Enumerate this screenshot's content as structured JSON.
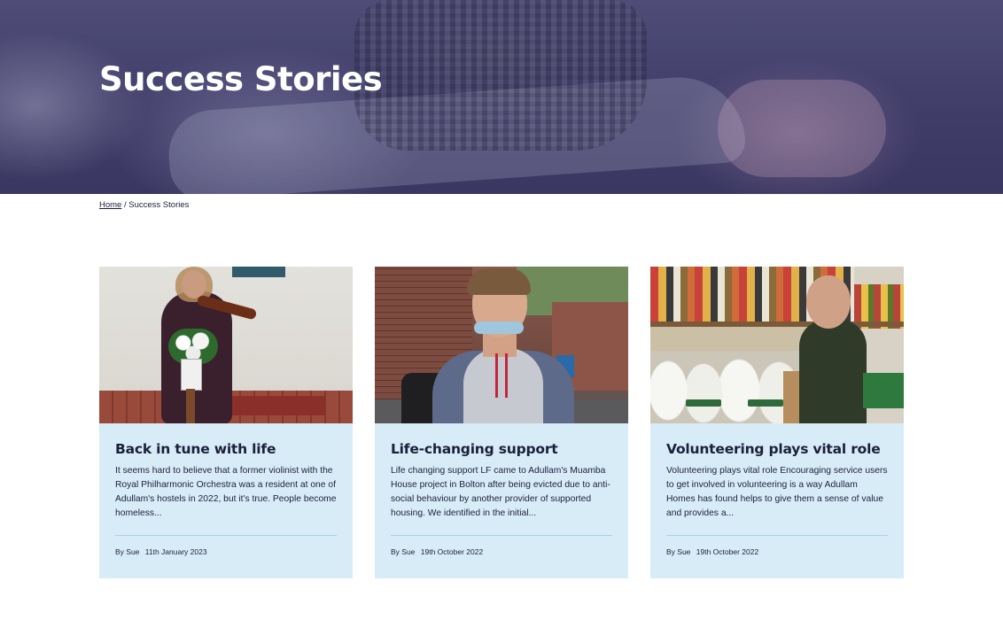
{
  "hero": {
    "title": "Success Stories"
  },
  "breadcrumb": {
    "home_label": "Home",
    "separator": "/",
    "current": "Success Stories"
  },
  "stories": [
    {
      "title": "Back in tune with life",
      "excerpt": "It seems hard to believe that a former violinist with the Royal Philharmonic Orchestra was a resident at one of Adullam's hostels in 2022, but it's true. People become homeless...",
      "author": "By Sue",
      "date": "11th January 2023"
    },
    {
      "title": "Life-changing support",
      "excerpt": "Life changing support LF came to Adullam's Muamba House project in Bolton after being evicted due to anti-social behaviour by another provider of supported housing. We identified in the initial...",
      "author": "By Sue",
      "date": "19th October 2022"
    },
    {
      "title": "Volunteering plays vital role",
      "excerpt": "Volunteering plays vital role Encouraging service users to get involved in volunteering is a way Adullam Homes has found helps to give them a sense of value and provides a...",
      "author": "By Sue",
      "date": "19th October 2022"
    }
  ],
  "colors": {
    "hero_overlay": "#3f3c68",
    "card_bg": "#d8ecf7",
    "text": "#1b1f3b",
    "divider": "#a9d2e6"
  }
}
